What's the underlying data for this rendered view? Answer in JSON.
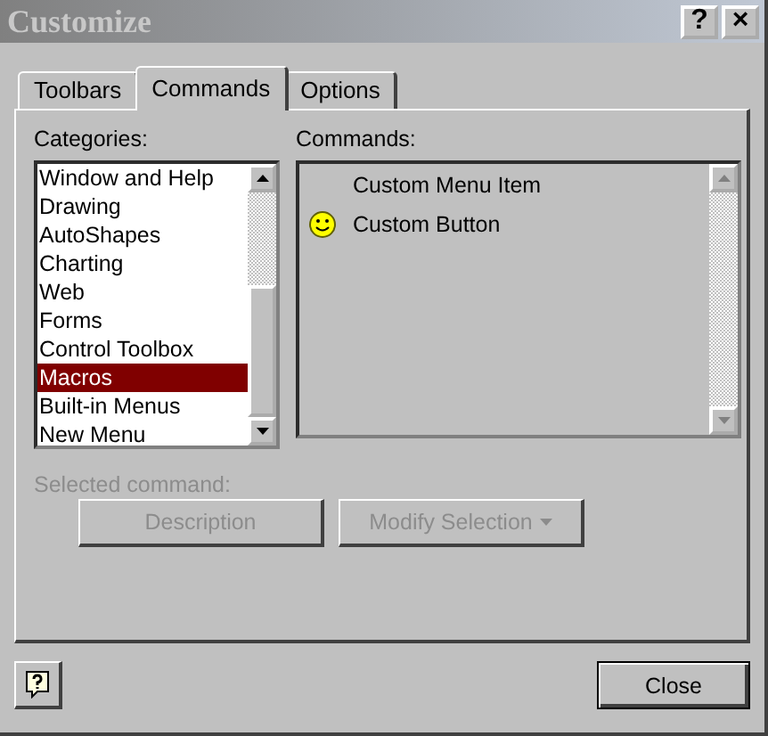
{
  "window": {
    "title": "Customize",
    "help_button": "?",
    "close_button": "×"
  },
  "tabs": [
    {
      "label": "Toolbars",
      "selected": false
    },
    {
      "label": "Commands",
      "selected": true
    },
    {
      "label": "Options",
      "selected": false
    }
  ],
  "categories": {
    "label": "Categories:",
    "items": [
      {
        "label": "Window and Help",
        "selected": false
      },
      {
        "label": "Drawing",
        "selected": false
      },
      {
        "label": "AutoShapes",
        "selected": false
      },
      {
        "label": "Charting",
        "selected": false
      },
      {
        "label": "Web",
        "selected": false
      },
      {
        "label": "Forms",
        "selected": false
      },
      {
        "label": "Control Toolbox",
        "selected": false
      },
      {
        "label": "Macros",
        "selected": true
      },
      {
        "label": "Built-in Menus",
        "selected": false
      },
      {
        "label": "New Menu",
        "selected": false
      }
    ]
  },
  "commands": {
    "label": "Commands:",
    "items": [
      {
        "label": "Custom Menu Item",
        "kind": "menu"
      },
      {
        "label": "Custom Button",
        "kind": "button"
      }
    ]
  },
  "selected_command": {
    "label": "Selected command:",
    "disabled": true,
    "buttons": [
      {
        "label": "Description",
        "kind": "plain"
      },
      {
        "label": "Modify Selection",
        "kind": "dropdown"
      }
    ]
  },
  "footer": {
    "close": "Close"
  }
}
